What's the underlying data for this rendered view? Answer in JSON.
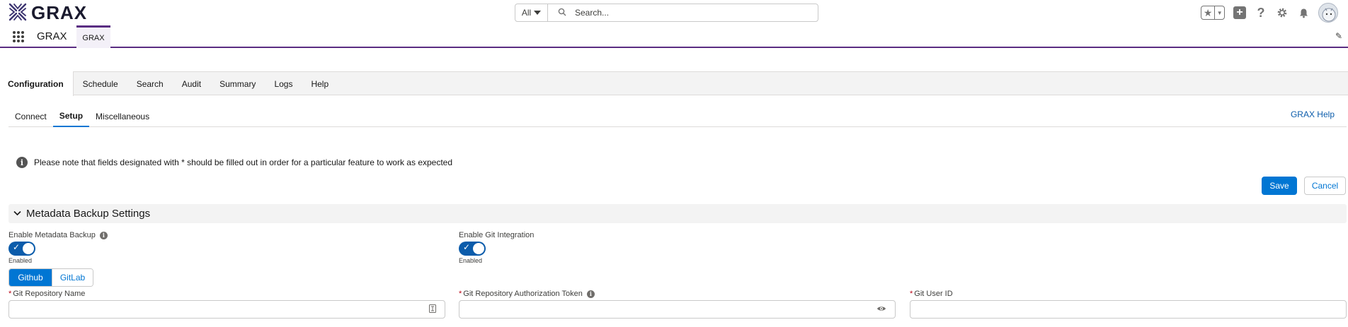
{
  "header": {
    "logo_text": "GRAX",
    "search_scope": "All",
    "search_placeholder": "Search..."
  },
  "appnav": {
    "app_name": "GRAX",
    "tab_label": "GRAX"
  },
  "main_tabs": [
    "Configuration",
    "Schedule",
    "Search",
    "Audit",
    "Summary",
    "Logs",
    "Help"
  ],
  "sub_tabs": [
    "Connect",
    "Setup",
    "Miscellaneous"
  ],
  "help_link": "GRAX Help",
  "notice": "Please note that fields designated with * should be filled out in order for a particular feature to work as expected",
  "buttons": {
    "save": "Save",
    "cancel": "Cancel"
  },
  "section": {
    "title": "Metadata Backup Settings"
  },
  "fields": {
    "metadata_backup": {
      "label": "Enable Metadata Backup",
      "status": "Enabled"
    },
    "git_integration": {
      "label": "Enable Git Integration",
      "status": "Enabled"
    },
    "provider": {
      "options": [
        "Github",
        "GitLab"
      ],
      "selected": "Github"
    },
    "repo_name": {
      "label": "Git Repository Name",
      "value": ""
    },
    "auth_token": {
      "label": "Git Repository Authorization Token",
      "value": ""
    },
    "user_id": {
      "label": "Git User ID",
      "value": ""
    },
    "required_mark": "*"
  },
  "colors": {
    "brand": "#5a2d82",
    "accent": "#0176d3"
  },
  "icons": [
    "grax-logo-icon",
    "search-icon",
    "favorites-star-icon",
    "add-icon",
    "help-icon",
    "setup-gear-icon",
    "notification-bell-icon",
    "avatar",
    "app-launcher-icon",
    "edit-pencil-icon",
    "info-icon",
    "chevron-down-icon",
    "checkmark-icon",
    "eye-icon",
    "text-field-icon"
  ]
}
